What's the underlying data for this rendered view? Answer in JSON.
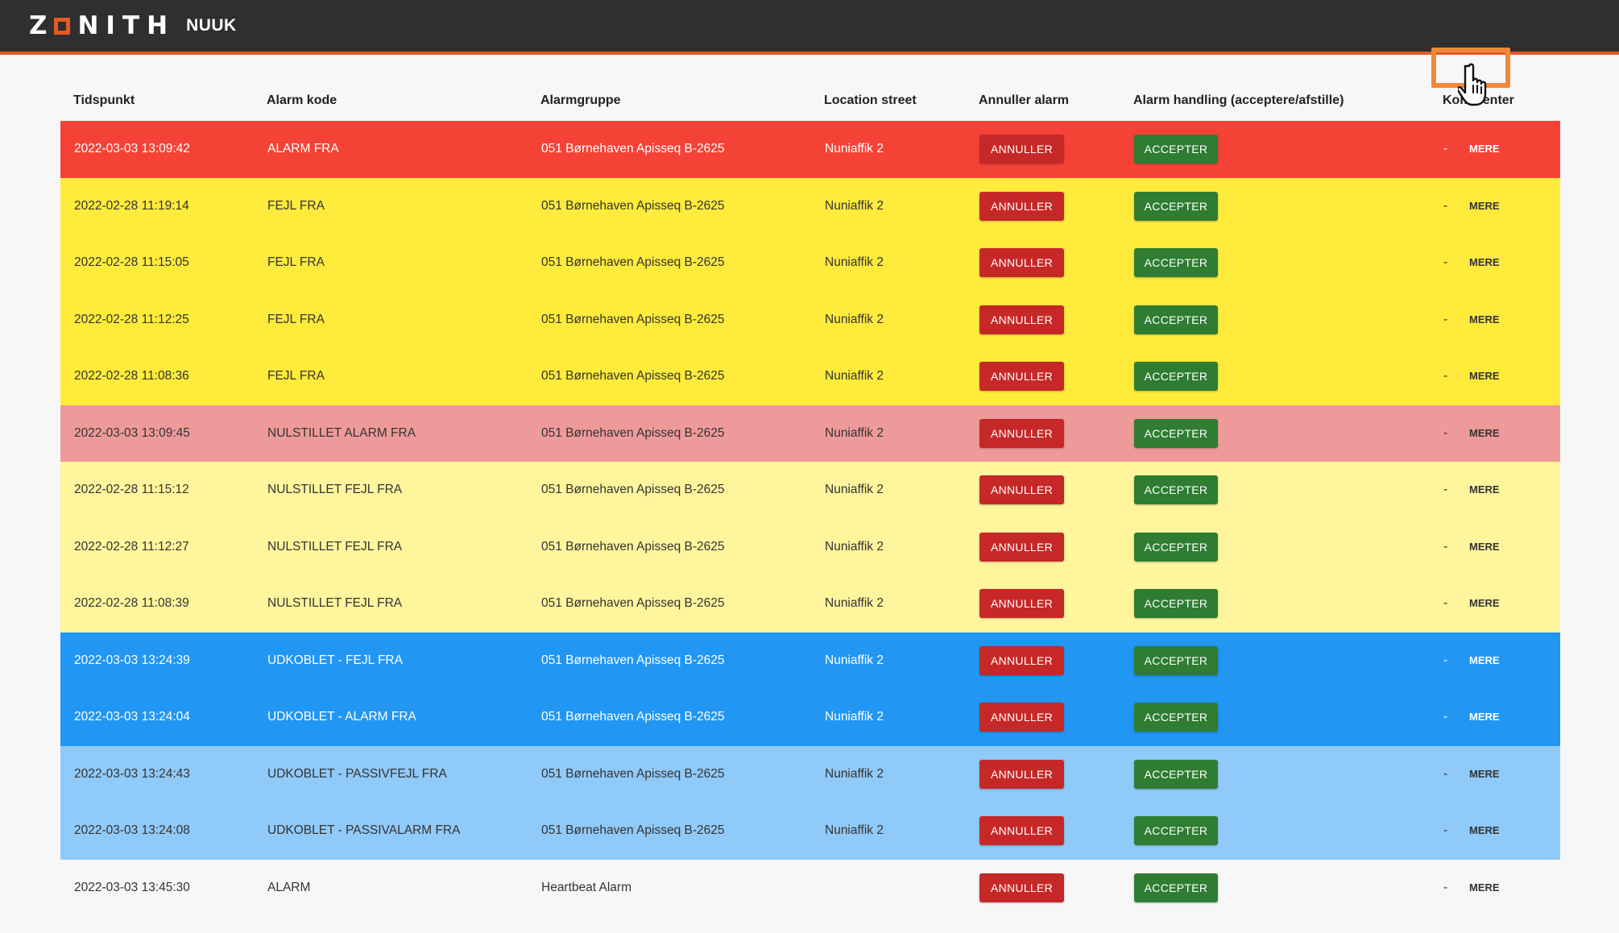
{
  "header": {
    "logo": "ZONITH",
    "site_name": "NUUK"
  },
  "table": {
    "columns": [
      "Tidspunkt",
      "Alarm kode",
      "Alarmgruppe",
      "Location street",
      "Annuller alarm",
      "Alarm handling (acceptere/afstille)",
      "Kommenter"
    ],
    "cancel_label": "ANNULLER",
    "accept_label": "ACCEPTER",
    "more_label": "MERE",
    "comment_dash": "-",
    "rows": [
      {
        "time": "2022-03-03 13:09:42",
        "code": "ALARM FRA",
        "group": "051 Børnehaven Apisseq B-2625",
        "street": "Nuniaffik 2",
        "status": "alarm"
      },
      {
        "time": "2022-02-28 11:19:14",
        "code": "FEJL FRA",
        "group": "051 Børnehaven Apisseq B-2625",
        "street": "Nuniaffik 2",
        "status": "fejl"
      },
      {
        "time": "2022-02-28 11:15:05",
        "code": "FEJL FRA",
        "group": "051 Børnehaven Apisseq B-2625",
        "street": "Nuniaffik 2",
        "status": "fejl"
      },
      {
        "time": "2022-02-28 11:12:25",
        "code": "FEJL FRA",
        "group": "051 Børnehaven Apisseq B-2625",
        "street": "Nuniaffik 2",
        "status": "fejl"
      },
      {
        "time": "2022-02-28 11:08:36",
        "code": "FEJL FRA",
        "group": "051 Børnehaven Apisseq B-2625",
        "street": "Nuniaffik 2",
        "status": "fejl"
      },
      {
        "time": "2022-03-03 13:09:45",
        "code": "NULSTILLET ALARM FRA",
        "group": "051 Børnehaven Apisseq B-2625",
        "street": "Nuniaffik 2",
        "status": "nulalarm"
      },
      {
        "time": "2022-02-28 11:15:12",
        "code": "NULSTILLET FEJL FRA",
        "group": "051 Børnehaven Apisseq B-2625",
        "street": "Nuniaffik 2",
        "status": "nulfejl"
      },
      {
        "time": "2022-02-28 11:12:27",
        "code": "NULSTILLET FEJL FRA",
        "group": "051 Børnehaven Apisseq B-2625",
        "street": "Nuniaffik 2",
        "status": "nulfejl"
      },
      {
        "time": "2022-02-28 11:08:39",
        "code": "NULSTILLET FEJL FRA",
        "group": "051 Børnehaven Apisseq B-2625",
        "street": "Nuniaffik 2",
        "status": "nulfejl"
      },
      {
        "time": "2022-03-03 13:24:39",
        "code": "UDKOBLET - FEJL FRA",
        "group": "051 Børnehaven Apisseq B-2625",
        "street": "Nuniaffik 2",
        "status": "udk"
      },
      {
        "time": "2022-03-03 13:24:04",
        "code": "UDKOBLET - ALARM FRA",
        "group": "051 Børnehaven Apisseq B-2625",
        "street": "Nuniaffik 2",
        "status": "udk"
      },
      {
        "time": "2022-03-03 13:24:43",
        "code": "UDKOBLET - PASSIVFEJL FRA",
        "group": "051 Børnehaven Apisseq B-2625",
        "street": "Nuniaffik 2",
        "status": "udkpassiv"
      },
      {
        "time": "2022-03-03 13:24:08",
        "code": "UDKOBLET - PASSIVALARM FRA",
        "group": "051 Børnehaven Apisseq B-2625",
        "street": "Nuniaffik 2",
        "status": "udkpassiv"
      },
      {
        "time": "2022-03-03 13:45:30",
        "code": "ALARM",
        "group": "Heartbeat Alarm",
        "street": "",
        "status": "plain"
      }
    ]
  },
  "colors": {
    "alarm": "#f44336",
    "fejl": "#ffeb3b",
    "nulalarm": "#ef9a9a",
    "nulfejl": "#fff59d",
    "udk": "#2196f3",
    "udkpassiv": "#90caf9",
    "cancel": "#c62828",
    "accept": "#2e7d32",
    "accent": "#e45a22"
  },
  "cursor_icon": "hand-pointer-icon"
}
